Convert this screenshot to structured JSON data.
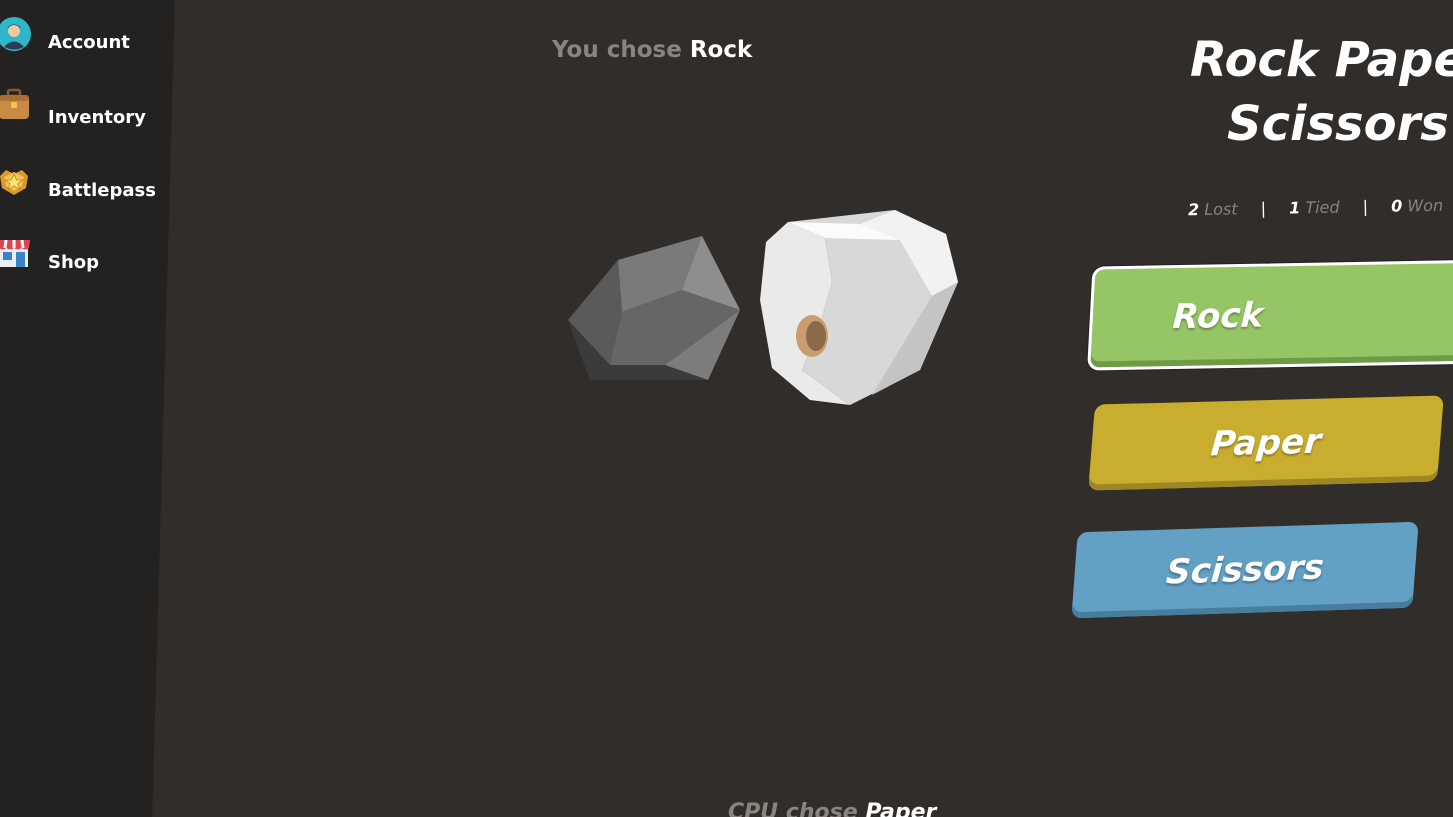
{
  "sidebar": {
    "items": [
      {
        "label": "Account",
        "icon": "account-icon"
      },
      {
        "label": "Inventory",
        "icon": "inventory-icon"
      },
      {
        "label": "Battlepass",
        "icon": "battlepass-icon"
      },
      {
        "label": "Shop",
        "icon": "shop-icon"
      }
    ]
  },
  "game": {
    "you_chose_prefix": "You chose",
    "you_chose_value": "Rock",
    "cpu_chose_prefix": "CPU chose",
    "cpu_chose_value": "Paper",
    "title_line1": "Rock Paper",
    "title_line2": "Scissors",
    "score": {
      "lost_count": "2",
      "lost_label": "Lost",
      "tied_count": "1",
      "tied_label": "Tied",
      "won_count": "0",
      "won_label": "Won"
    },
    "buttons": {
      "rock": "Rock",
      "paper": "Paper",
      "scissors": "Scissors"
    }
  },
  "colors": {
    "background": "#312d2a",
    "sidebar": "#242220",
    "rock_button": "#95c565",
    "paper_button": "#c9ad2e",
    "scissors_button": "#62a0c4"
  }
}
